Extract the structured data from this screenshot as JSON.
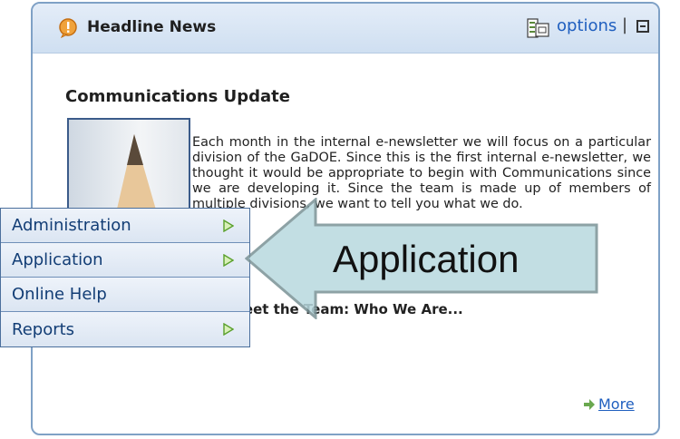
{
  "panel": {
    "title": "Headline News",
    "options_label": "options",
    "separator": "|",
    "icons": [
      "warning-bubble-icon",
      "options-icon",
      "collapse-icon"
    ]
  },
  "article": {
    "title": "Communications Update",
    "body": "Each month in the internal e-newsletter we will focus on a particular division of the GaDOE. Since this is the first internal e-newsletter, we thought it would be appropriate to begin with Communications since we are developing it. Since the team is made up of members of multiple divisions, we want to tell you what we do.",
    "subheading": "Meet the Team: Who We Are...",
    "more_label": "More"
  },
  "side_menu": {
    "items": [
      {
        "label": "Administration",
        "has_submenu": true
      },
      {
        "label": "Application",
        "has_submenu": true
      },
      {
        "label": "Online Help",
        "has_submenu": false
      },
      {
        "label": "Reports",
        "has_submenu": true
      }
    ]
  },
  "callout": {
    "label": "Application",
    "fill_color": "#b8d9df",
    "stroke_color": "#7a9296"
  },
  "colors": {
    "link": "#1f5fbf",
    "panel_border": "#7fa1c6",
    "menu_text": "#123d75"
  }
}
